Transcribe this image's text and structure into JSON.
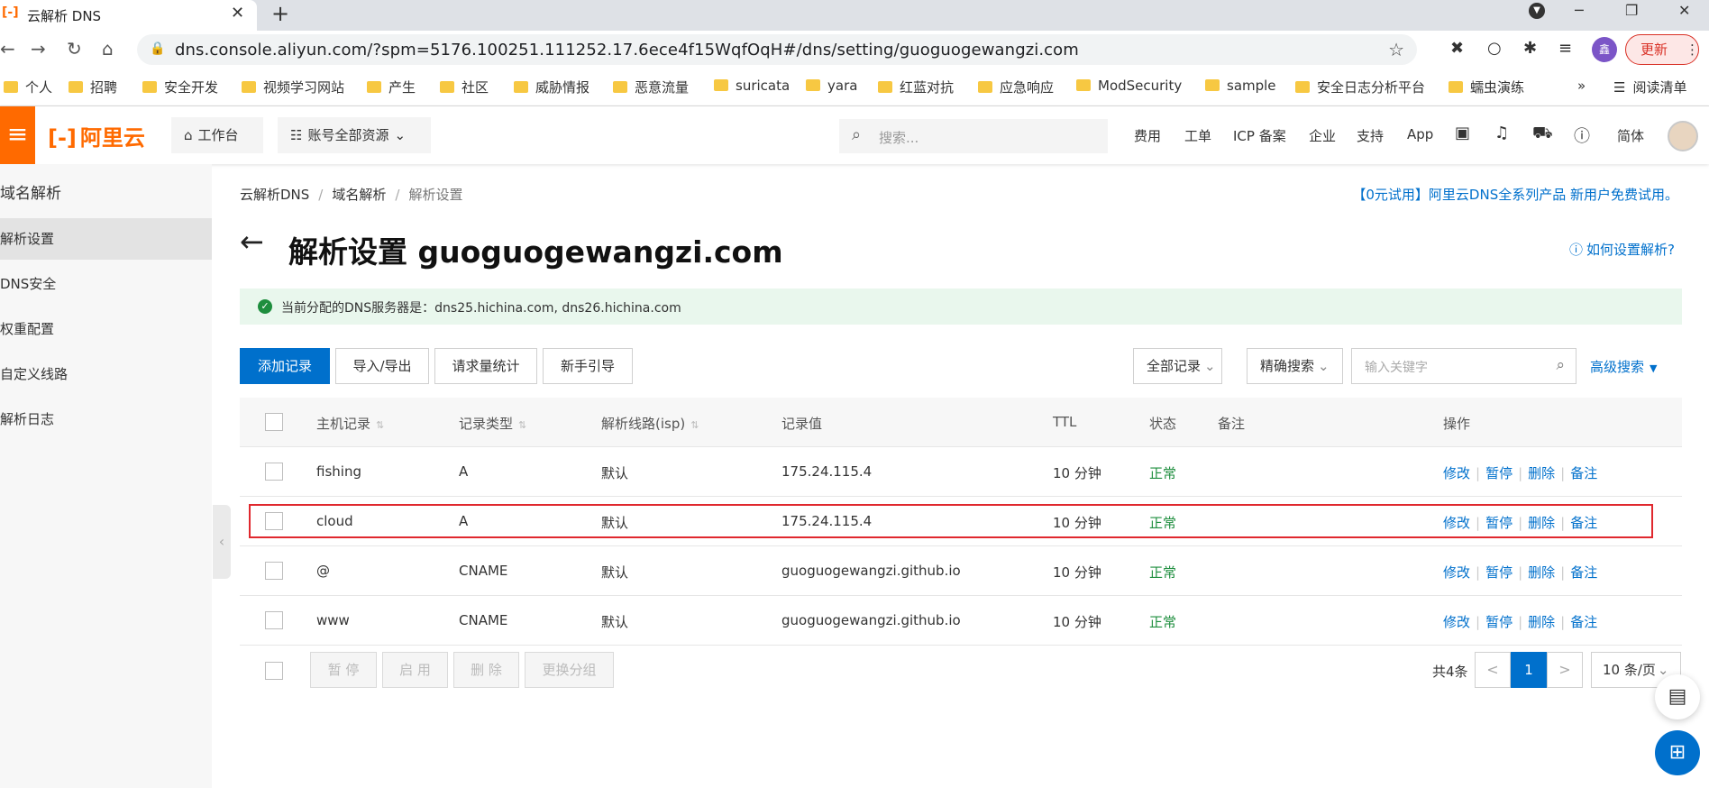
{
  "browser": {
    "tab_title": "云解析 DNS",
    "favicon": "[-]",
    "url": "dns.console.aliyun.com/?spm=5176.100251.111252.17.6ece4f15WqfOqH#/dns/setting/guoguogewangzi.com",
    "update_label": "更新",
    "profile_initial": "鑫",
    "bookmarks": [
      "个人",
      "招聘",
      "安全开发",
      "视频学习网站",
      "产生",
      "社区",
      "威胁情报",
      "恶意流量",
      "suricata",
      "yara",
      "红蓝对抗",
      "应急响应",
      "ModSecurity",
      "sample",
      "安全日志分析平台",
      "蠕虫演练"
    ],
    "more_bookmarks": "»",
    "reading_list": "阅读清单"
  },
  "topbar": {
    "logo": "阿里云",
    "workbench": "工作台",
    "resources": "账号全部资源",
    "search_placeholder": "搜索...",
    "links": [
      "费用",
      "工单",
      "ICP 备案",
      "企业",
      "支持",
      "App"
    ],
    "lang": "简体"
  },
  "sidebar": {
    "title": "域名解析",
    "items": [
      "解析设置",
      "DNS安全",
      "权重配置",
      "自定义线路",
      "解析日志"
    ],
    "active_index": 0
  },
  "breadcrumb": [
    "云解析DNS",
    "域名解析",
    "解析设置"
  ],
  "promo": "【0元试用】阿里云DNS全系列产品 新用户免费试用。",
  "page": {
    "title": "解析设置 guoguogewangzi.com",
    "help": "如何设置解析?",
    "notice": "当前分配的DNS服务器是：dns25.hichina.com, dns26.hichina.com"
  },
  "toolbar": {
    "add": "添加记录",
    "import_export": "导入/导出",
    "stats": "请求量统计",
    "guide": "新手引导",
    "filter_all": "全部记录",
    "filter_exact": "精确搜索",
    "keyword_placeholder": "输入关键字",
    "advanced": "高级搜索"
  },
  "table": {
    "headers": [
      "主机记录",
      "记录类型",
      "解析线路(isp)",
      "记录值",
      "TTL",
      "状态",
      "备注",
      "操作"
    ],
    "rows": [
      [
        "fishing",
        "A",
        "默认",
        "175.24.115.4",
        "10 分钟",
        "正常",
        ""
      ],
      [
        "cloud",
        "A",
        "默认",
        "175.24.115.4",
        "10 分钟",
        "正常",
        ""
      ],
      [
        "@",
        "CNAME",
        "默认",
        "guoguogewangzi.github.io",
        "10 分钟",
        "正常",
        ""
      ],
      [
        "www",
        "CNAME",
        "默认",
        "guoguogewangzi.github.io",
        "10 分钟",
        "正常",
        ""
      ]
    ],
    "actions": [
      "修改",
      "暂停",
      "删除",
      "备注"
    ]
  },
  "footer": {
    "bulk": [
      "暂 停",
      "启 用",
      "删 除",
      "更换分组"
    ],
    "total": "共4条",
    "prev": "<",
    "current_page": "1",
    "next": ">",
    "page_size": "10 条/页"
  },
  "colors": {
    "brand": "#ff6a00",
    "primary": "#0070cc",
    "ok": "#1e8e3e",
    "highlight": "#e0282e"
  }
}
